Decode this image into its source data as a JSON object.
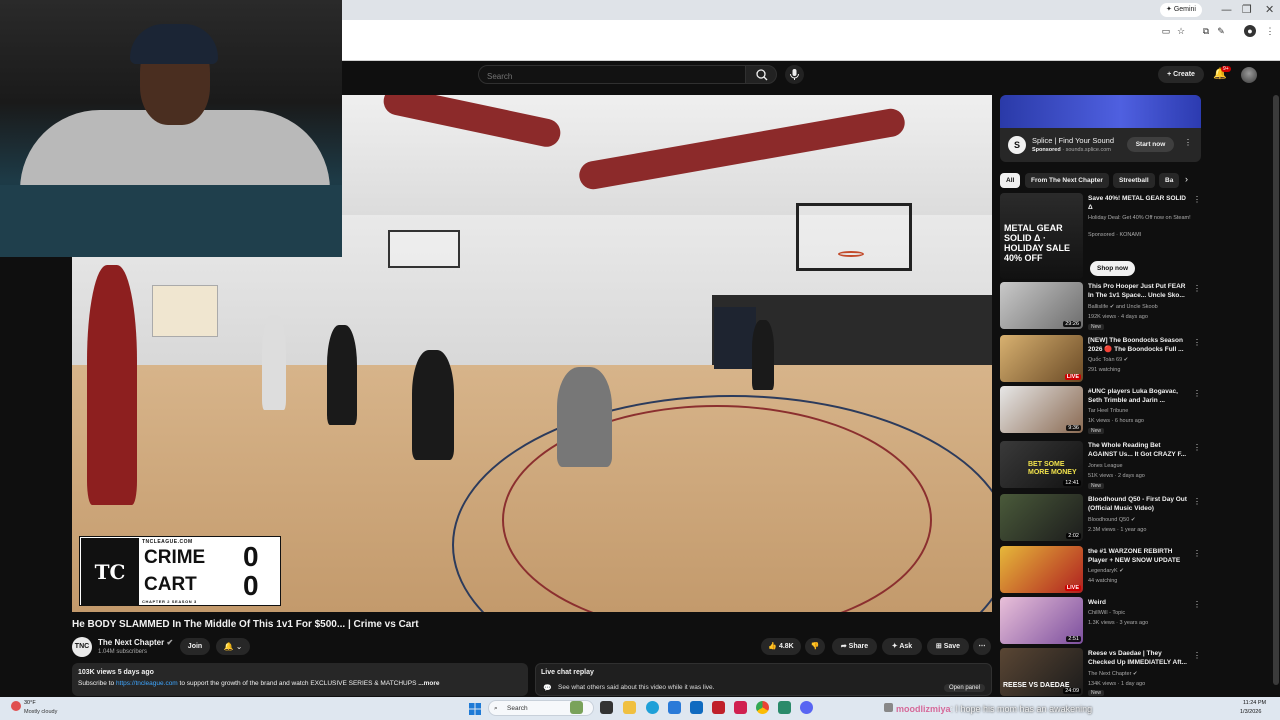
{
  "browser": {
    "gemini_label": "Gemini",
    "window_controls": [
      "—",
      "❐",
      "✕"
    ]
  },
  "header": {
    "search_placeholder": "Search",
    "create_label": "Create",
    "notification_count": "9+"
  },
  "video": {
    "scorebug": {
      "league": "TNCLEAGUE.COM",
      "team1": "CRIME",
      "team2": "CART",
      "score1": "0",
      "score2": "0",
      "season": "CHAPTER 2 SEASON 3",
      "logo_text": "TC"
    },
    "title": "He BODY SLAMMED In The Middle Of This 1v1 For $500... | Crime vs Cart",
    "channel": {
      "avatar_text": "TNC",
      "name": "The Next Chapter",
      "subscribers": "1.04M subscribers"
    },
    "join_label": "Join",
    "actions": {
      "likes": "4.8K",
      "share": "Share",
      "ask": "Ask",
      "save": "Save"
    },
    "description": {
      "meta": "103K views  5 days ago",
      "prefix": "Subscribe to ",
      "link": "https://tncleague.com",
      "suffix": " to support the growth of the brand and watch EXCLUSIVE SERIES & MATCHUPS ",
      "more": "...more"
    },
    "live_chat": {
      "title": "Live chat replay",
      "subtitle": "See what others said about this video while it was live.",
      "open_panel": "Open panel"
    }
  },
  "sidebar": {
    "ad": {
      "title": "Splice | Find Your Sound",
      "sponsored": "Sponsored",
      "domain": "sounds.splice.com",
      "cta": "Start now"
    },
    "chips": [
      "All",
      "From The Next Chapter",
      "Streetball",
      "Ba"
    ],
    "recommendations": [
      {
        "title": "Save 40%! METAL GEAR SOLID Δ",
        "meta1": "Holiday Deal: Get 40% Off now on Steam!",
        "meta2": "Sponsored · KONAMI",
        "cta": "Shop now",
        "thumb_text": "METAL GEAR SOLID Δ · HOLIDAY SALE 40% OFF",
        "badge": ""
      },
      {
        "title": "This Pro Hooper Just Put FEAR In The 1v1 Space... Uncle Sko...",
        "meta1": "Ballislife ✔ and Uncle Skoob",
        "meta2": "192K views · 4 days ago",
        "duration": "29:26",
        "badge": "New"
      },
      {
        "title": "[NEW] The Boondocks Season 2026 🔴 The Boondocks Full ...",
        "meta1": "Quốc Toàn 69 ✔",
        "meta2": "291 watching",
        "live": "LIVE",
        "badge": ""
      },
      {
        "title": "#UNC players Luka Bogavac, Seth Trimble and Jarin ...",
        "meta1": "Tar Heel Tribune",
        "meta2": "1K views · 6 hours ago",
        "duration": "9:36",
        "badge": "New"
      },
      {
        "title": "The Whole Reading Bet AGAINST Us... It Got CRAZY F...",
        "meta1": "Jones League",
        "meta2": "51K views · 2 days ago",
        "duration": "12:41",
        "badge": "New",
        "thumb_text": "BET SOME MORE MONEY"
      },
      {
        "title": "Bloodhound Q50 - First Day Out (Official Music Video)",
        "meta1": "Bloodhound Q50 ✔",
        "meta2": "2.3M views · 1 year ago",
        "duration": "2:02",
        "badge": ""
      },
      {
        "title": "the #1 WARZONE REBIRTH Player + NEW SNOW UPDATE",
        "meta1": "LegendaryK ✔",
        "meta2": "44 watching",
        "live": "LIVE",
        "badge": ""
      },
      {
        "title": "Weird",
        "meta1": "ChillWill - Topic",
        "meta2": "1.3K views · 3 years ago",
        "duration": "2:51",
        "badge": ""
      },
      {
        "title": "Reese vs Daedae | They Checked Up IMMEDIATELY Aft...",
        "meta1": "The Next Chapter ✔",
        "meta2": "134K views · 1 day ago",
        "duration": "24:09",
        "badge": "New",
        "thumb_text": "REESE VS DAEDAE"
      }
    ]
  },
  "taskbar": {
    "weather_temp": "30°F",
    "weather_desc": "Mostly cloudy",
    "search_label": "Search",
    "time": "11:24 PM",
    "date": "1/3/2026"
  },
  "stream_chat": {
    "user": "moodlizmiya",
    "message": ": I hope his mom has an awakening"
  },
  "colors": {
    "yt_bg": "#0f0f0f",
    "accent_red": "#cc0000",
    "link_blue": "#3ea6ff",
    "chip_active_bg": "#f1f1f1"
  }
}
